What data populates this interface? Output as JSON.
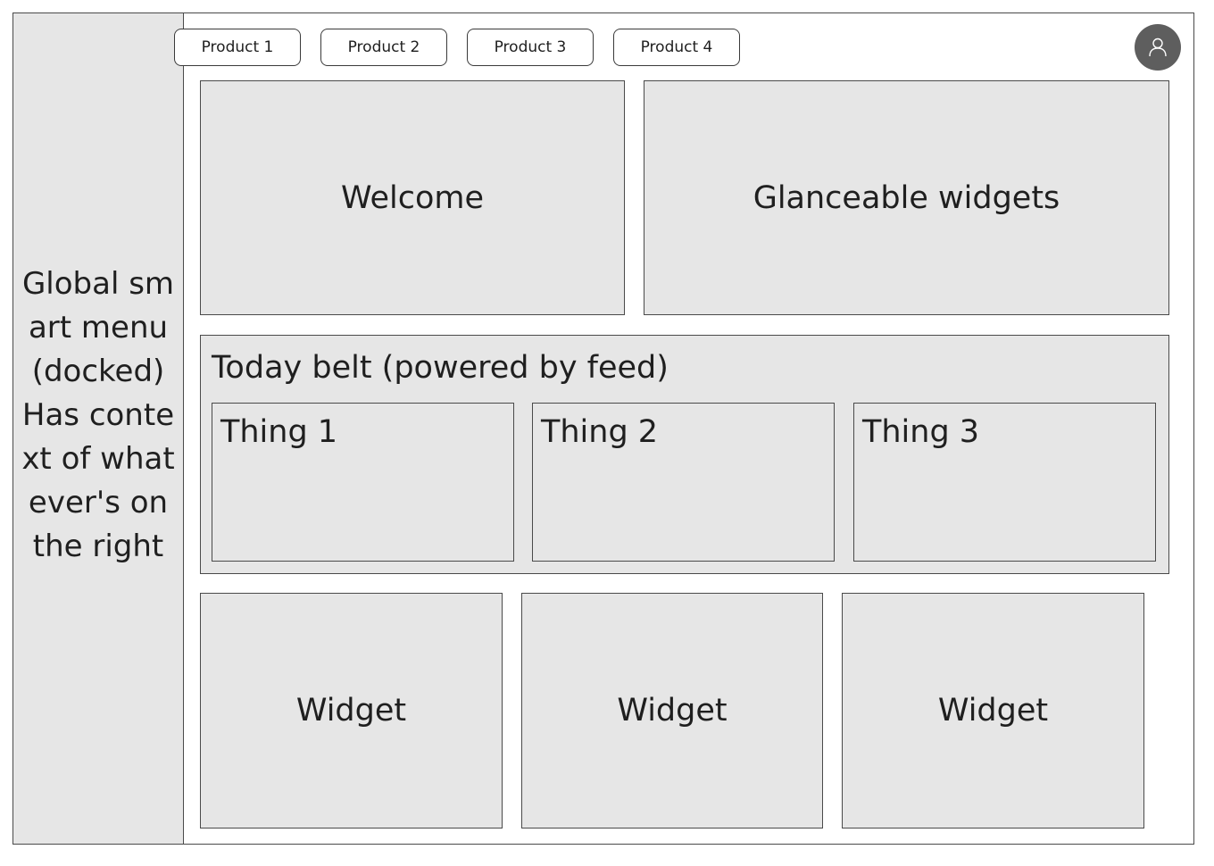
{
  "sidebar": {
    "text": "Global smart menu (docked) Has context of whatever's on the right"
  },
  "header": {
    "tabs": [
      {
        "label": "Product 1"
      },
      {
        "label": "Product 2"
      },
      {
        "label": "Product 3"
      },
      {
        "label": "Product 4"
      }
    ],
    "avatar_icon": "user-icon"
  },
  "main": {
    "welcome_label": "Welcome",
    "glanceable_label": "Glanceable widgets",
    "today_belt": {
      "title": "Today belt (powered by feed)",
      "things": [
        {
          "label": "Thing 1"
        },
        {
          "label": "Thing 2"
        },
        {
          "label": "Thing 3"
        }
      ]
    },
    "widgets": [
      {
        "label": "Widget"
      },
      {
        "label": "Widget"
      },
      {
        "label": "Widget"
      }
    ]
  },
  "colors": {
    "panel_fill": "#e6e6e6",
    "border": "#4a4a4a",
    "avatar": "#5e5e5e"
  }
}
